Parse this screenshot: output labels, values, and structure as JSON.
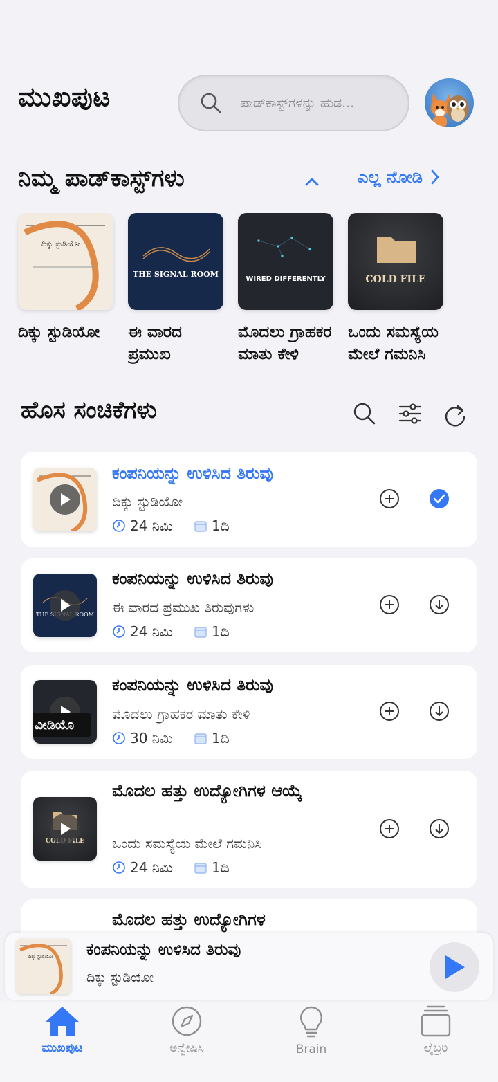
{
  "header": {
    "title": "ಮುಖಪುಟ",
    "search_placeholder": "ಪಾಡ್‌ಕಾಸ್ಟ್‌ಗಳನ್ನು ಹುಡ..."
  },
  "your_podcasts": {
    "title": "ನಿಮ್ಮ ಪಾಡ್‌ಕಾಸ್ಟ್‌ಗಳು",
    "see_all": "ಎಲ್ಲ ನೋಡಿ",
    "items": [
      {
        "name": "ದಿಕ್ಕು ಸ್ಟುಡಿಯೋ",
        "cover_text": "ದಿಕ್ಕು ಸ್ಟುಡಿಯೋ"
      },
      {
        "name": "ಈ ವಾರದ ಪ್ರಮುಖ ತಿರುವುಗಳು",
        "cover_text": "THE SIGNAL ROOM"
      },
      {
        "name": "ಮೊದಲು ಗ್ರಾಹಕರ ಮಾತು ಕೇಳಿ",
        "cover_text": "WIRED DIFFERENTLY"
      },
      {
        "name": "ಒಂದು ಸಮಸ್ಯೆಯ ಮೇಲೆ ಗಮನಿಸಿ",
        "cover_text": "COLD FILE"
      }
    ]
  },
  "new_episodes": {
    "title": "ಹೊಸ ಸಂಚಿಕೆಗಳು",
    "items": [
      {
        "title": "ಕಂಪನಿಯನ್ನು ಉಳಿಸಿದ ತಿರುವು",
        "podcast": "ದಿಕ್ಕು ಸ್ಟುಡಿಯೋ",
        "duration": "24 ನಿಮಿ",
        "age": "1ದಿ",
        "status": "downloaded",
        "playing": true
      },
      {
        "title": "ಕಂಪನಿಯನ್ನು ಉಳಿಸಿದ ತಿರುವು",
        "podcast": "ಈ ವಾರದ ಪ್ರಮುಖ ತಿರುವುಗಳು",
        "duration": "24 ನಿಮಿ",
        "age": "1ದಿ",
        "status": "download"
      },
      {
        "title": "ಕಂಪನಿಯನ್ನು ಉಳಿಸಿದ ತಿರುವು",
        "podcast": "ಮೊದಲು ಗ್ರಾಹಕರ ಮಾತು ಕೇಳಿ",
        "duration": "30 ನಿಮಿ",
        "age": "1ದಿ",
        "status": "download",
        "badge": "ವೀಡಿಯೊ"
      },
      {
        "title": "ಮೊದಲ ಹತ್ತು ಉದ್ಯೋಗಿಗಳ ಆಯ್ಕೆ",
        "podcast": "ಒಂದು ಸಮಸ್ಯೆಯ ಮೇಲೆ ಗಮನಿಸಿ",
        "duration": "24 ನಿಮಿ",
        "age": "1ದಿ",
        "status": "download"
      },
      {
        "title": "ಮೊದಲ ಹತ್ತು ಉದ್ಯೋಗಿಗಳ",
        "podcast": "",
        "duration": "",
        "age": ""
      }
    ]
  },
  "mini_player": {
    "title": "ಕಂಪನಿಯನ್ನು ಉಳಿಸಿದ ತಿರುವು",
    "podcast": "ದಿಕ್ಕು ಸ್ಟುಡಿಯೋ"
  },
  "tabs": [
    {
      "label": "ಮುಖಪುಟ",
      "icon": "home-icon",
      "active": true
    },
    {
      "label": "ಅನ್ವೇಷಿಸಿ",
      "icon": "compass-icon"
    },
    {
      "label": "Brain",
      "icon": "lightbulb-icon"
    },
    {
      "label": "ಲೈಬ್ರರಿ",
      "icon": "library-icon"
    }
  ],
  "colors": {
    "accent": "#3478f6",
    "background": "#f2f2f7"
  }
}
